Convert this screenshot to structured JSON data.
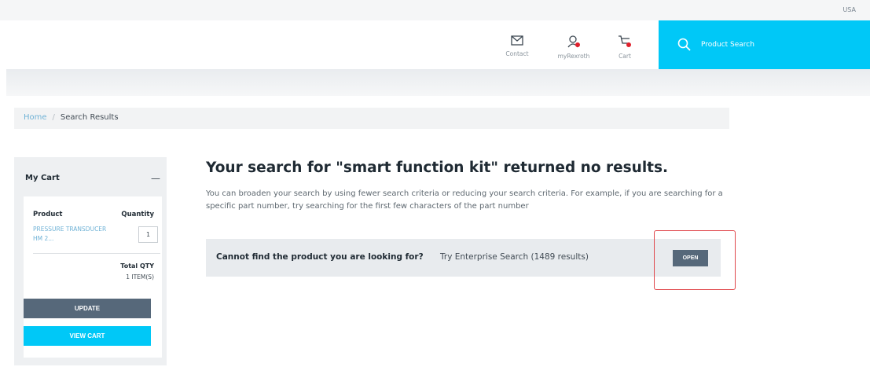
{
  "topbar": {
    "region": "USA"
  },
  "header": {
    "contact_label": "Contact",
    "myrexroth_label": "myRexroth",
    "cart_label": "Cart",
    "search_label": "Product Search",
    "accent_color": "#00c8f7",
    "badge_color": "#e0202c"
  },
  "breadcrumb": {
    "home": "Home",
    "separator": "/",
    "current": "Search Results"
  },
  "cart": {
    "title": "My Cart",
    "collapse_symbol": "—",
    "col_product": "Product",
    "col_quantity": "Quantity",
    "product_name": "PRESSURE TRANSDUCER HM 2...",
    "quantity": "1",
    "total_qty_label": "Total QTY",
    "total_qty_value": "1 ITEM(S)",
    "update_label": "UPDATE",
    "viewcart_label": "VIEW CART"
  },
  "results": {
    "title": "Your search for \"smart function kit\" returned no results.",
    "description": "You can broaden your search by using fewer search criteria or reducing your search criteria. For example, if you are searching for a specific part number, try searching for the first few characters of the part number",
    "enterprise_question": "Cannot find the product you are looking for?",
    "enterprise_text": "Try Enterprise Search (1489 results)",
    "open_label": "OPEN",
    "highlight_color": "#e0484c"
  }
}
